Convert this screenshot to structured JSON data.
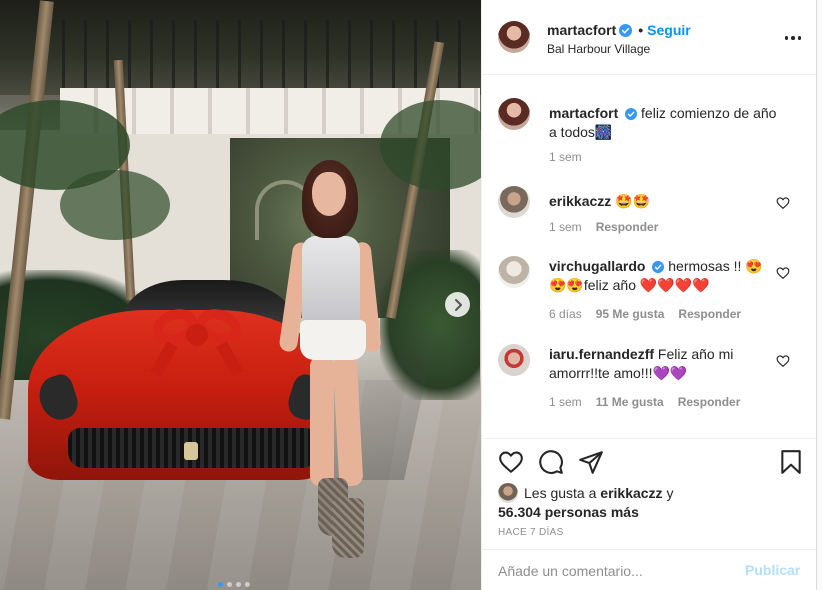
{
  "post": {
    "author": "martacfort",
    "follow_label": "Seguir",
    "separator": "•",
    "location": "Bal Harbour Village",
    "caption_text": "feliz comienzo de año a todos🎆",
    "caption_time": "1 sem",
    "carousel": {
      "current_slide": 1,
      "total_slides": 4
    }
  },
  "comments": [
    {
      "user": "erikkaczz",
      "text": "🤩🤩",
      "time": "1 sem",
      "likes": "",
      "reply": "Responder"
    },
    {
      "user": "virchugallardo",
      "verified": true,
      "text": "hermosas !! 😍😍😍feliz año ❤️❤️❤️❤️",
      "time": "6 días",
      "likes": "95 Me gusta",
      "reply": "Responder"
    },
    {
      "user": "iaru.fernandezff",
      "text": "Feliz año mi amorrr!!te amo!!!💜💜",
      "time": "1 sem",
      "likes": "11 Me gusta",
      "reply": "Responder"
    }
  ],
  "likes": {
    "prefix": "Les gusta a",
    "first_user": "erikkaczz",
    "connector": "y",
    "others": "56.304 personas más"
  },
  "timestamp": "Hace 7 días",
  "add_comment": {
    "placeholder": "Añade un comentario...",
    "publish_label": "Publicar"
  },
  "colors": {
    "link_blue": "#0095f6",
    "publish_disabled": "#b2dffc",
    "verified_blue": "#3897f0",
    "muted": "#8e8e8e"
  },
  "icons": [
    "verified-badge-icon",
    "more-options-icon",
    "heart-icon",
    "comment-icon",
    "share-icon",
    "bookmark-icon",
    "next-arrow-icon"
  ]
}
